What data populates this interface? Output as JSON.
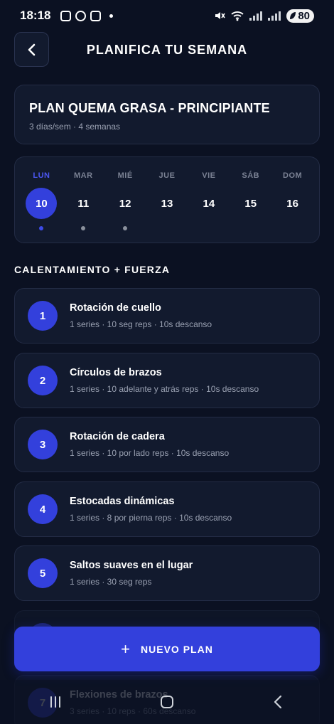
{
  "status": {
    "time": "18:18",
    "battery": "80"
  },
  "header": {
    "title": "PLANIFICA TU SEMANA"
  },
  "plan": {
    "title": "PLAN QUEMA GRASA - PRINCIPIANTE",
    "subtitle": "3 días/sem · 4 semanas"
  },
  "week": [
    {
      "name": "LUN",
      "num": "10",
      "active": true,
      "dot": "active"
    },
    {
      "name": "MAR",
      "num": "11",
      "active": false,
      "dot": "grey"
    },
    {
      "name": "MIÉ",
      "num": "12",
      "active": false,
      "dot": "grey"
    },
    {
      "name": "JUE",
      "num": "13",
      "active": false,
      "dot": "none"
    },
    {
      "name": "VIE",
      "num": "14",
      "active": false,
      "dot": "none"
    },
    {
      "name": "SÁB",
      "num": "15",
      "active": false,
      "dot": "none"
    },
    {
      "name": "DOM",
      "num": "16",
      "active": false,
      "dot": "none"
    }
  ],
  "section": {
    "title": "CALENTAMIENTO + FUERZA"
  },
  "exercises": [
    {
      "num": "1",
      "name": "Rotación de cuello",
      "meta": "1 series · 10 seg reps · 10s descanso"
    },
    {
      "num": "2",
      "name": "Círculos de brazos",
      "meta": "1 series · 10 adelante y atrás reps · 10s descanso"
    },
    {
      "num": "3",
      "name": "Rotación de cadera",
      "meta": "1 series · 10 por lado reps · 10s descanso"
    },
    {
      "num": "4",
      "name": "Estocadas dinámicas",
      "meta": "1 series · 8 por pierna reps · 10s descanso"
    },
    {
      "num": "5",
      "name": "Saltos suaves en el lugar",
      "meta": "1 series · 30 seg reps"
    },
    {
      "num": "6",
      "name": "",
      "meta": ""
    },
    {
      "num": "7",
      "name": "Flexiones de brazos",
      "meta": "3 series · 10 reps · 60s descanso"
    }
  ],
  "fab": {
    "label": "NUEVO PLAN"
  },
  "colors": {
    "background": "#0b1122",
    "card": "#121a2e",
    "accent": "#3340dc",
    "muted_text": "#9aa1b2"
  },
  "icons": {
    "back": "chevron-left-icon",
    "plus": "plus-icon",
    "nav_recents": "recents-icon",
    "nav_home": "home-icon",
    "nav_back": "nav-back-icon"
  }
}
